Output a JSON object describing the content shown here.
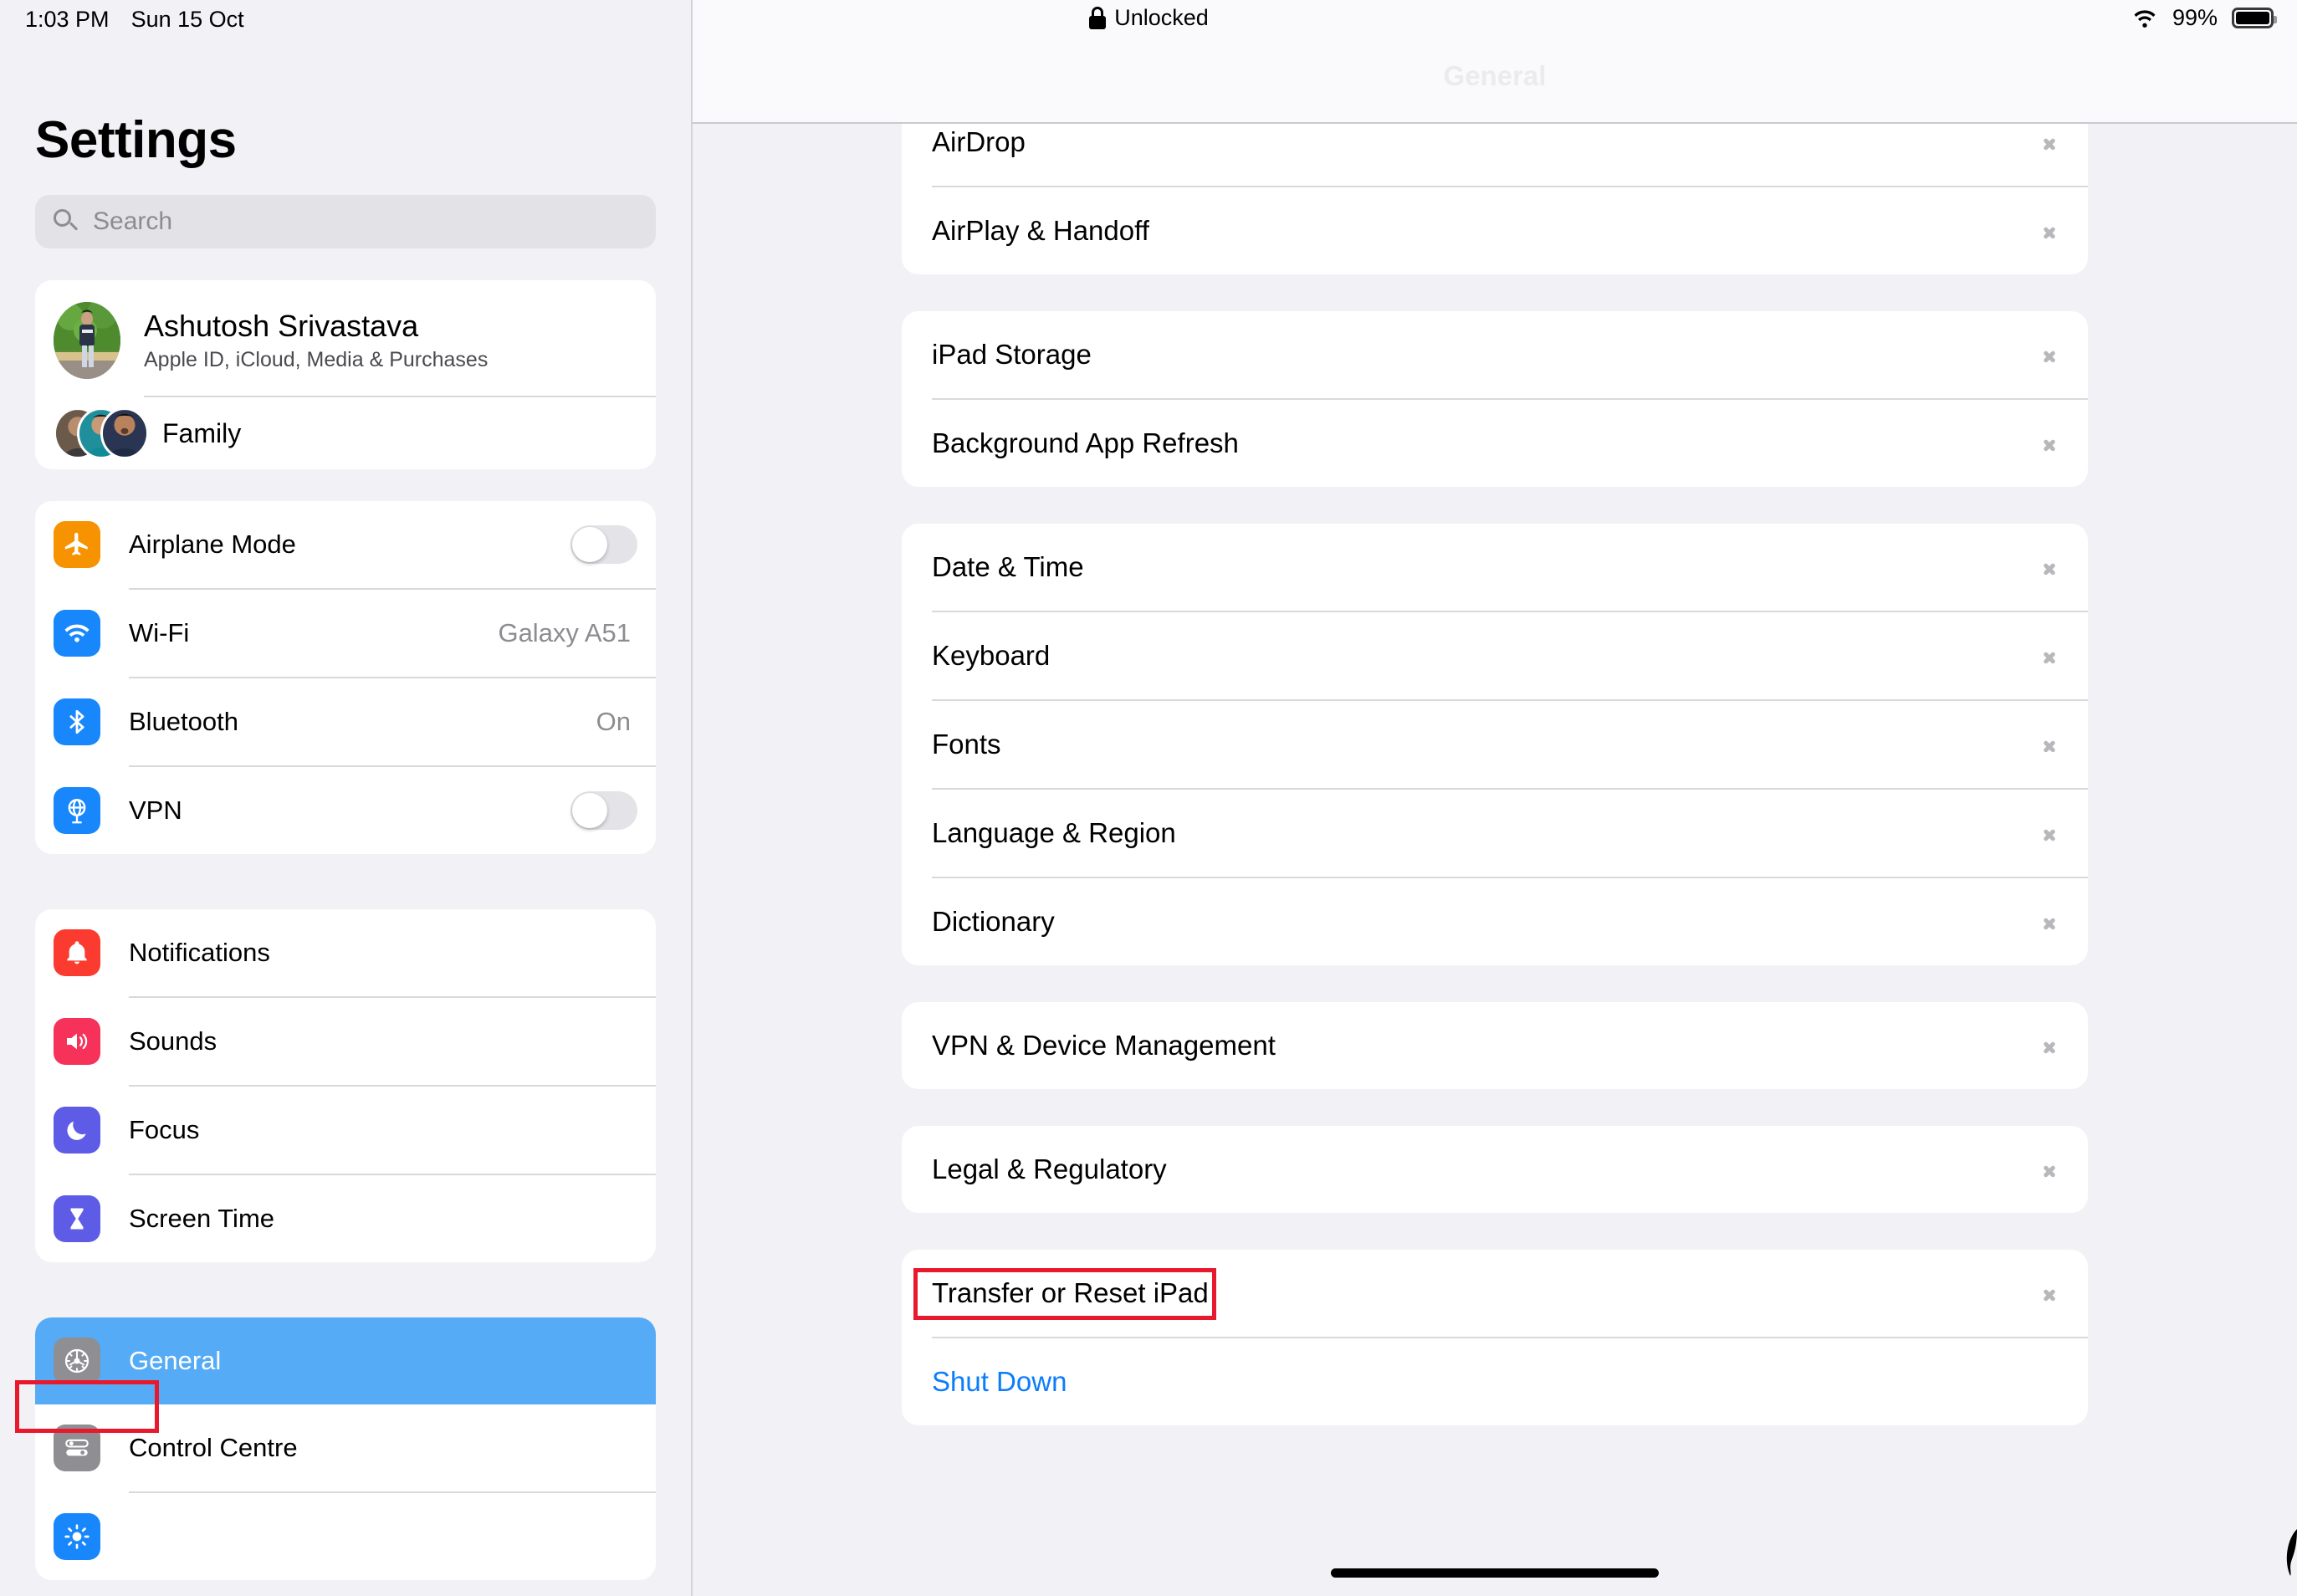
{
  "statusbar": {
    "time": "1:03 PM",
    "date": "Sun 15 Oct",
    "lock_status": "Unlocked",
    "battery_percent": "99%",
    "wifi_icon": "wifi-icon",
    "battery_icon": "battery-icon",
    "lock_icon": "unlocked-lock-icon"
  },
  "sidebar": {
    "title": "Settings",
    "search": {
      "placeholder": "Search",
      "value": ""
    },
    "profile": {
      "name": "Ashutosh Srivastava",
      "subtitle": "Apple ID, iCloud, Media & Purchases",
      "family_label": "Family"
    },
    "groups": [
      {
        "items": [
          {
            "label": "Airplane Mode",
            "icon": "airplane-icon",
            "accessory": "toggle",
            "toggle_on": false,
            "icon_color": "#f79300"
          },
          {
            "label": "Wi-Fi",
            "icon": "wifi-icon",
            "accessory": "value",
            "value": "Galaxy A51",
            "icon_color": "#1787fb"
          },
          {
            "label": "Bluetooth",
            "icon": "bluetooth-icon",
            "accessory": "value",
            "value": "On",
            "icon_color": "#1787fb"
          },
          {
            "label": "VPN",
            "icon": "vpn-globe-icon",
            "accessory": "toggle",
            "toggle_on": false,
            "icon_color": "#1787fb"
          }
        ]
      },
      {
        "items": [
          {
            "label": "Notifications",
            "icon": "bell-icon",
            "accessory": "none",
            "icon_color": "#fb3b30"
          },
          {
            "label": "Sounds",
            "icon": "speaker-icon",
            "accessory": "none",
            "icon_color": "#f6315a"
          },
          {
            "label": "Focus",
            "icon": "moon-icon",
            "accessory": "none",
            "icon_color": "#5e5ce6"
          },
          {
            "label": "Screen Time",
            "icon": "hourglass-icon",
            "accessory": "none",
            "icon_color": "#5e5ce6"
          }
        ]
      },
      {
        "items": [
          {
            "label": "General",
            "icon": "gear-icon",
            "accessory": "none",
            "selected": true,
            "icon_color": "#8e8e93"
          },
          {
            "label": "Control Centre",
            "icon": "control-centre-icon",
            "accessory": "none",
            "icon_color": "#8e8e93"
          },
          {
            "label": "",
            "icon": "display-brightness-icon",
            "accessory": "none",
            "icon_color": "#1787fb"
          }
        ]
      }
    ],
    "selected_item": "General",
    "selection_color": "#55abf5"
  },
  "main": {
    "header_title": "General",
    "groups": [
      {
        "items": [
          {
            "label": "AirDrop",
            "accessory": "chevron"
          },
          {
            "label": "AirPlay & Handoff",
            "accessory": "chevron"
          }
        ]
      },
      {
        "items": [
          {
            "label": "iPad Storage",
            "accessory": "chevron"
          },
          {
            "label": "Background App Refresh",
            "accessory": "chevron"
          }
        ]
      },
      {
        "items": [
          {
            "label": "Date & Time",
            "accessory": "chevron"
          },
          {
            "label": "Keyboard",
            "accessory": "chevron"
          },
          {
            "label": "Fonts",
            "accessory": "chevron"
          },
          {
            "label": "Language & Region",
            "accessory": "chevron"
          },
          {
            "label": "Dictionary",
            "accessory": "chevron"
          }
        ]
      },
      {
        "items": [
          {
            "label": "VPN & Device Management",
            "accessory": "chevron"
          }
        ]
      },
      {
        "items": [
          {
            "label": "Legal & Regulatory",
            "accessory": "chevron"
          }
        ]
      },
      {
        "items": [
          {
            "label": "Transfer or Reset iPad",
            "accessory": "chevron",
            "highlighted": true
          },
          {
            "label": "Shut Down",
            "accessory": "none",
            "style": "link"
          }
        ]
      }
    ]
  },
  "annotations": {
    "highlight_color": "#e8192c",
    "boxes": [
      {
        "target": "General",
        "location": "sidebar"
      },
      {
        "target": "Transfer or Reset iPad",
        "location": "main"
      }
    ]
  }
}
